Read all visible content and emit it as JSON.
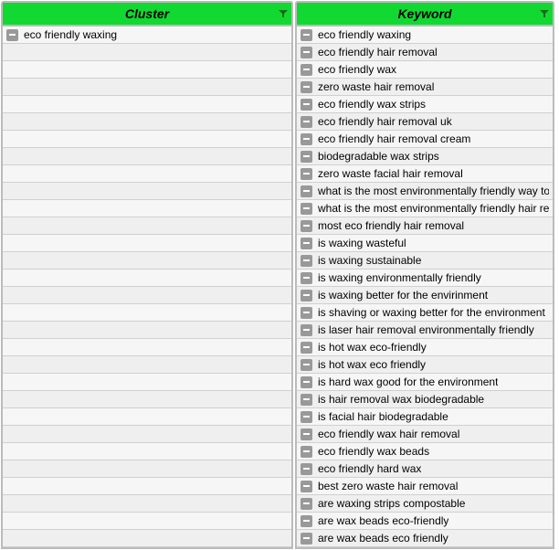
{
  "columns": {
    "cluster": {
      "header": "Cluster"
    },
    "keyword": {
      "header": "Keyword"
    }
  },
  "cluster_rows": [
    "eco friendly waxing"
  ],
  "keyword_rows": [
    "eco friendly waxing",
    "eco friendly hair removal",
    "eco friendly wax",
    "zero waste hair removal",
    "eco friendly wax strips",
    "eco friendly hair removal uk",
    "eco friendly hair removal cream",
    "biodegradable wax strips",
    "zero waste facial hair removal",
    "what is the most environmentally friendly way to re",
    "what is the most environmentally friendly hair rem",
    "most eco friendly hair removal",
    "is waxing wasteful",
    "is waxing sustainable",
    "is waxing environmentally friendly",
    "is waxing better for the envirinment",
    "is shaving or waxing better for the environment",
    "is laser hair removal environmentally friendly",
    "is hot wax eco-friendly",
    "is hot wax eco friendly",
    "is hard wax good for the environment",
    "is hair removal wax biodegradable",
    "is facial hair biodegradable",
    "eco friendly wax hair removal",
    "eco friendly wax beads",
    "eco friendly hard wax",
    "best zero waste hair removal",
    "are waxing strips compostable",
    "are wax beads eco-friendly",
    "are wax beads eco friendly"
  ],
  "total_visible_rows": 30
}
